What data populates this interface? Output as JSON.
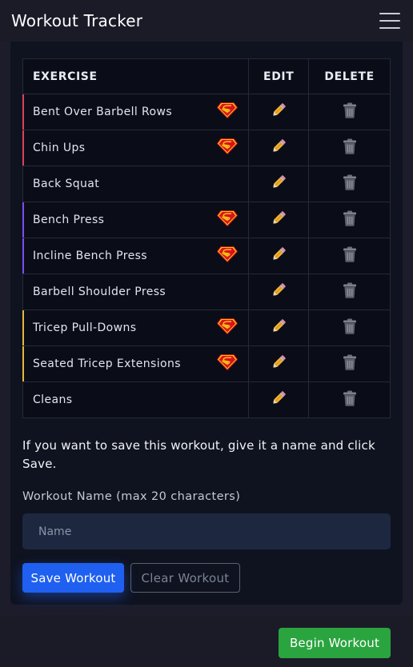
{
  "app": {
    "title": "Workout Tracker"
  },
  "table": {
    "headers": {
      "exercise": "EXERCISE",
      "edit": "EDIT",
      "delete": "DELETE"
    },
    "rows": [
      {
        "name": "Bent Over Barbell Rows",
        "superset": true,
        "group_color": "#e0405a"
      },
      {
        "name": "Chin Ups",
        "superset": true,
        "group_color": "#e0405a"
      },
      {
        "name": "Back Squat",
        "superset": false,
        "group_color": ""
      },
      {
        "name": "Bench Press",
        "superset": true,
        "group_color": "#7b4ef0"
      },
      {
        "name": "Incline Bench Press",
        "superset": true,
        "group_color": "#7b4ef0"
      },
      {
        "name": "Barbell Shoulder Press",
        "superset": false,
        "group_color": ""
      },
      {
        "name": "Tricep Pull-Downs",
        "superset": true,
        "group_color": "#e5b83a"
      },
      {
        "name": "Seated Tricep Extensions",
        "superset": true,
        "group_color": "#e5b83a"
      },
      {
        "name": "Cleans",
        "superset": false,
        "group_color": ""
      }
    ]
  },
  "save_section": {
    "instructions": "If you want to save this workout, give it a name and click Save.",
    "name_label": "Workout Name (max 20 characters)",
    "name_placeholder": "Name",
    "name_value": "",
    "save_label": "Save Workout",
    "clear_label": "Clear Workout"
  },
  "footer": {
    "begin_label": "Begin Workout"
  },
  "colors": {
    "primary": "#1f60f0",
    "success": "#2aa43f",
    "background": "#0f1320"
  },
  "icons": {
    "edit": "pencil-icon",
    "delete": "trash-icon",
    "superset": "superman-icon",
    "menu": "hamburger-menu-icon"
  }
}
